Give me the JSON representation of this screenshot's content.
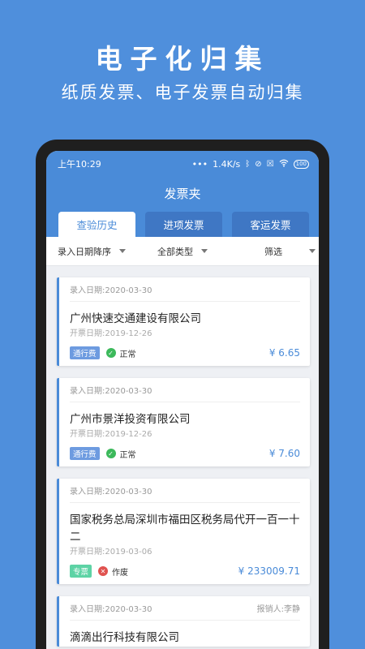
{
  "promo": {
    "title": "电子化归集",
    "subtitle": "纸质发票、电子发票自动归集"
  },
  "status_bar": {
    "time": "上午10:29",
    "dots": "•••",
    "speed": "1.4K/s",
    "battery": "100"
  },
  "app": {
    "title": "发票夹"
  },
  "tabs": [
    {
      "label": "查验历史",
      "active": true
    },
    {
      "label": "进项发票",
      "active": false
    },
    {
      "label": "客运发票",
      "active": false
    }
  ],
  "filters": [
    {
      "label": "录入日期降序"
    },
    {
      "label": "全部类型"
    },
    {
      "label": "筛选"
    }
  ],
  "cards": [
    {
      "entry_date": "录入日期:2020-03-30",
      "reporter": "",
      "company": "广州快速交通建设有限公司",
      "issue_date": "开票日期:2019-12-26",
      "tag": "通行费",
      "status": "正常",
      "amount": "¥ 6.65"
    },
    {
      "entry_date": "录入日期:2020-03-30",
      "reporter": "",
      "company": "广州市景洋投资有限公司",
      "issue_date": "开票日期:2019-12-26",
      "tag": "通行费",
      "status": "正常",
      "amount": "¥ 7.60"
    },
    {
      "entry_date": "录入日期:2020-03-30",
      "reporter": "",
      "company": "国家税务总局深圳市福田区税务局代开一百一十二",
      "issue_date": "开票日期:2019-03-06",
      "tag": "专票",
      "status": "作废",
      "amount": "¥ 233009.71"
    },
    {
      "entry_date": "录入日期:2020-03-30",
      "reporter": "报销人:李静",
      "company": "滴滴出行科技有限公司",
      "issue_date": "",
      "tag": "",
      "status": "",
      "amount": ""
    }
  ],
  "colors": {
    "background": "#4f8fdc",
    "header": "#4a8bd8",
    "tab_inactive": "#3f77c4",
    "ok": "#3cb95b",
    "void": "#e0524f",
    "tag_blue": "#6d9be0",
    "tag_green": "#5dd3a5"
  }
}
